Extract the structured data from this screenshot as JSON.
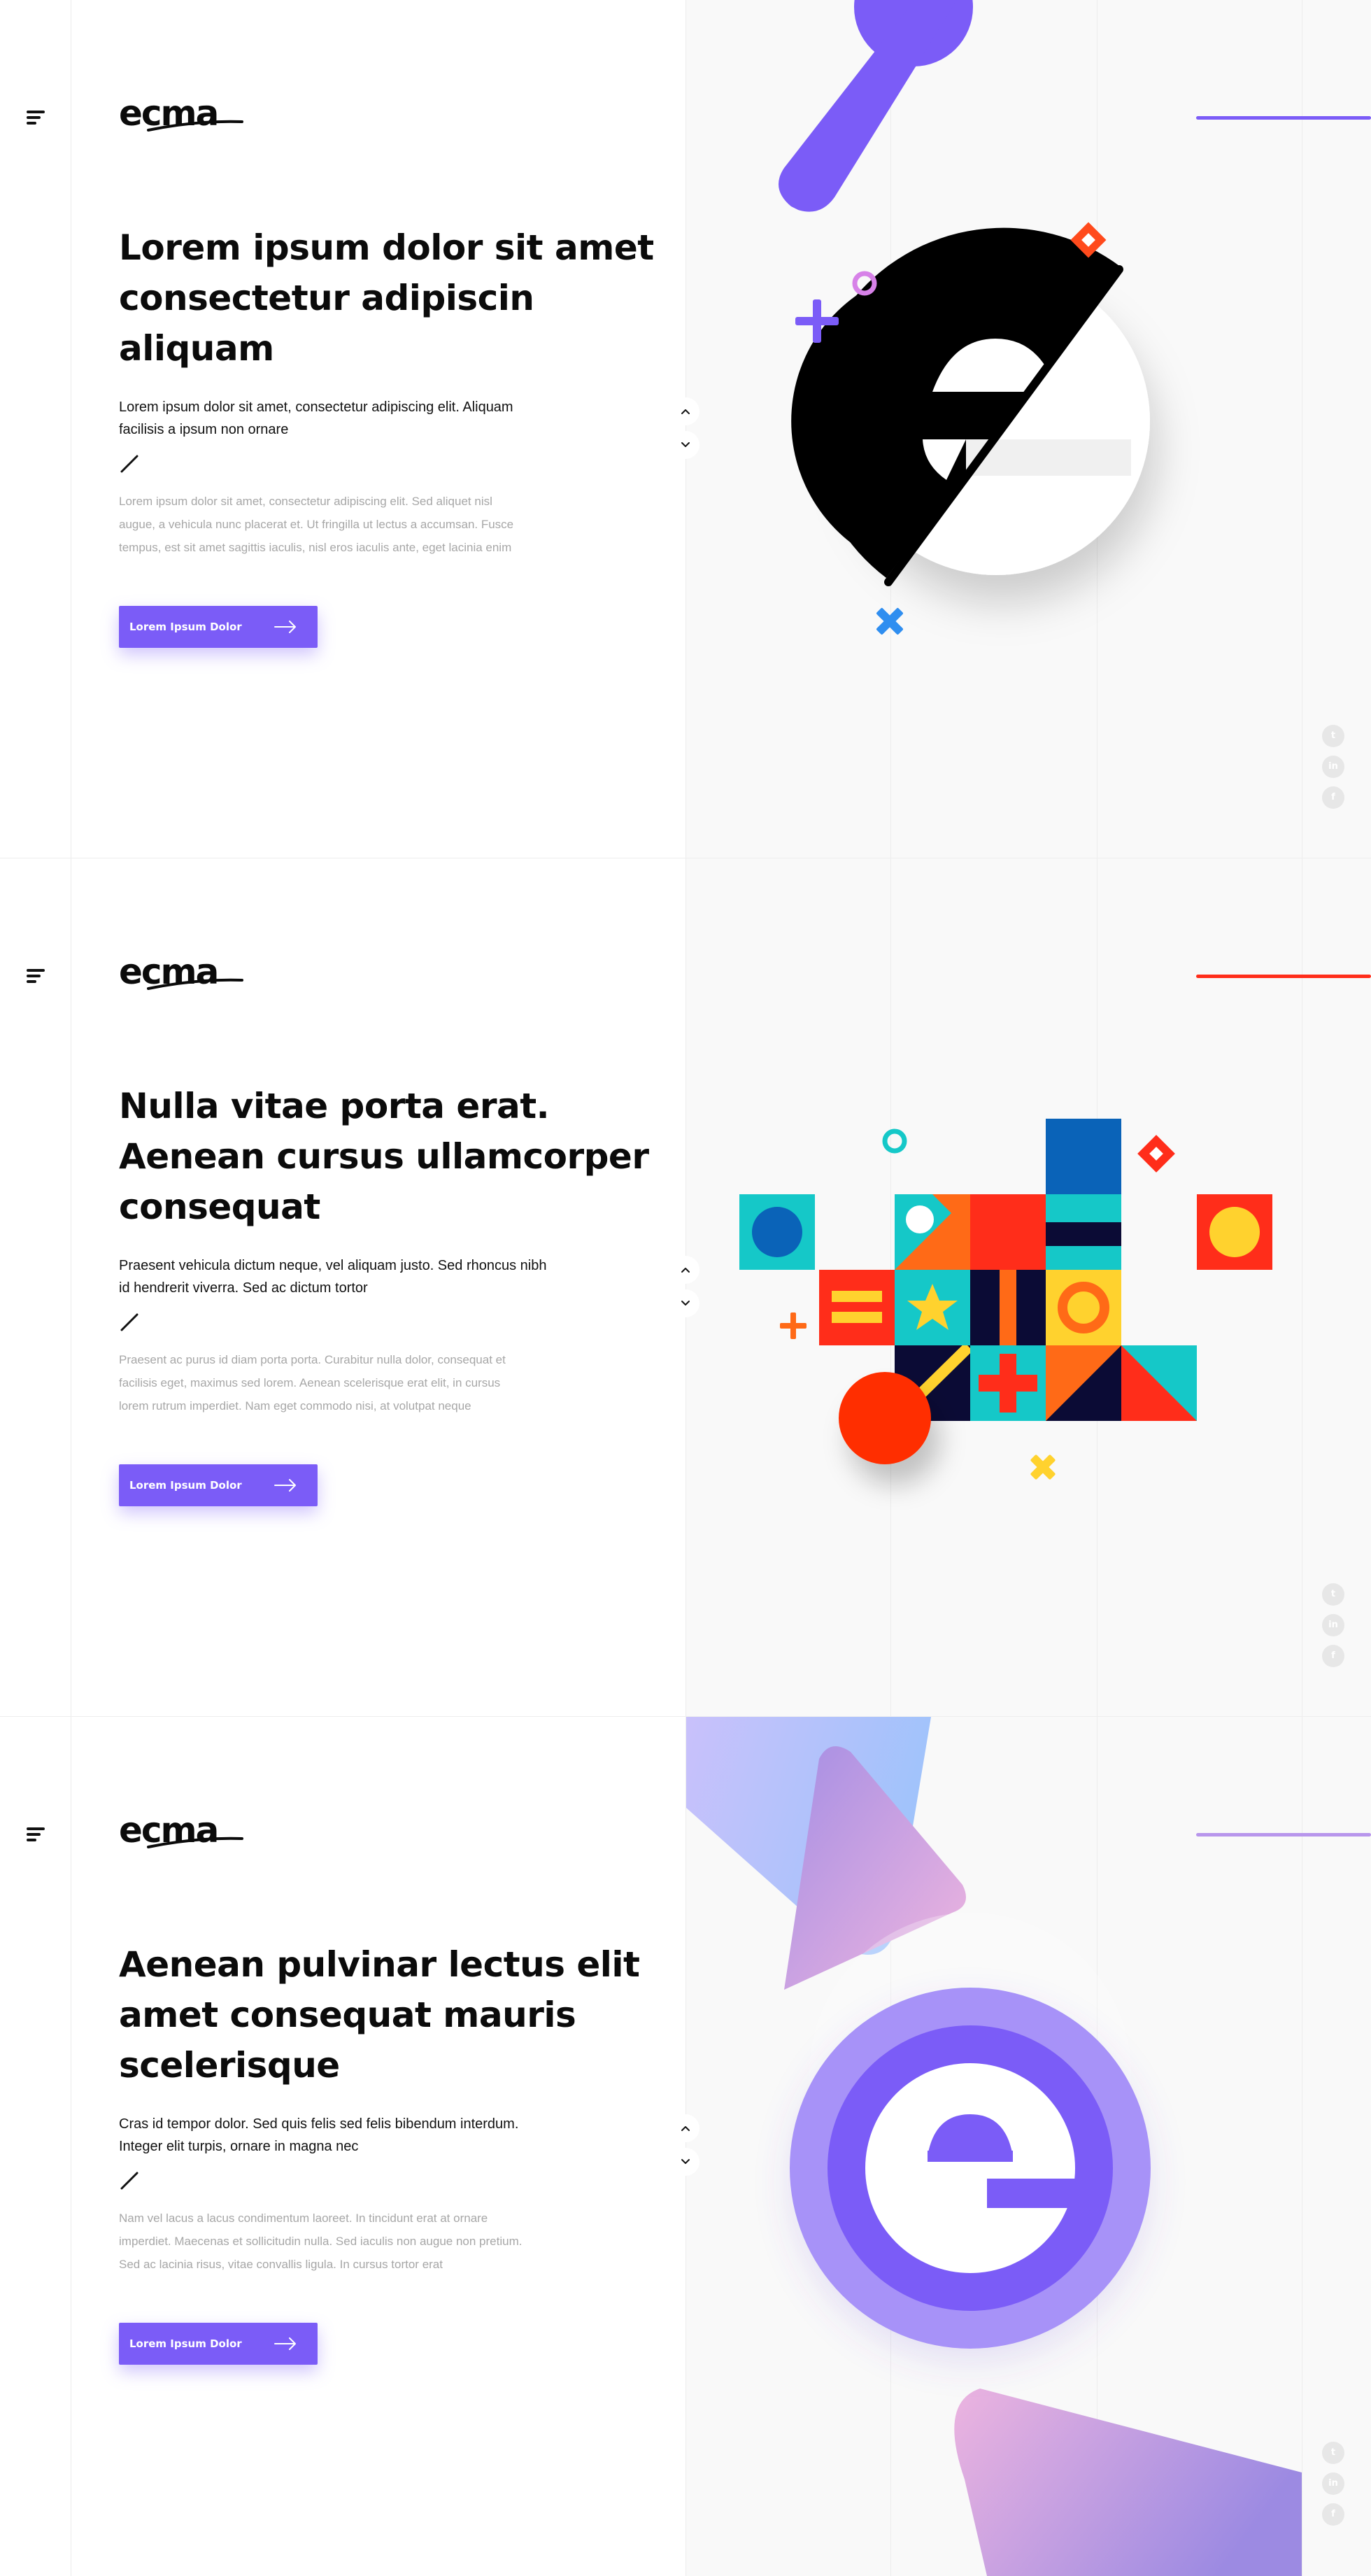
{
  "logo": {
    "text": "ecma"
  },
  "colors": {
    "accent": "#7b5cf7",
    "heading": "#0b0b0b",
    "body_muted": "#a7a7a7",
    "section2_accent_line": "#ff2d1a",
    "section3_accent_line": "#b896ec"
  },
  "icons": {
    "menu": "hamburger-menu-icon",
    "pager_up": "chevron-up-icon",
    "pager_down": "chevron-down-icon",
    "cta_arrow": "arrow-right-icon",
    "social": [
      "twitter-icon",
      "linkedin-icon",
      "facebook-icon"
    ]
  },
  "social_labels": [
    "t",
    "in",
    "f"
  ],
  "sections": [
    {
      "headline": "Lorem ipsum dolor sit amet consectetur adipiscin aliquam",
      "lead": "Lorem ipsum dolor sit amet, consectetur adipiscing elit. Aliquam facilisis a ipsum non ornare",
      "body": "Lorem ipsum dolor sit amet, consectetur adipiscing elit. Sed aliquet nisl augue, a vehicula nunc placerat et. Ut fringilla ut lectus a accumsan. Fusce tempus, est sit amet sagittis iaculis, nisl eros iaculis ante, eget lacinia enim",
      "cta_label": "Lorem Ipsum Dolor"
    },
    {
      "headline": "Nulla vitae porta erat. Aenean cursus ullamcorper consequat",
      "lead": "Praesent vehicula dictum neque, vel aliquam justo. Sed rhoncus nibh id hendrerit viverra. Sed ac dictum tortor",
      "body": "Praesent ac purus id diam porta porta. Curabitur nulla dolor, consequat et facilisis eget, maximus sed lorem. Aenean scelerisque erat elit, in cursus lorem rutrum imperdiet. Nam eget commodo nisi, at volutpat neque",
      "cta_label": "Lorem Ipsum Dolor"
    },
    {
      "headline": "Aenean pulvinar lectus elit amet consequat mauris scelerisque",
      "lead": "Cras id tempor dolor. Sed quis felis sed felis bibendum interdum. Integer elit turpis, ornare in magna nec",
      "body": "Nam vel lacus a lacus condimentum laoreet. In tincidunt erat at ornare imperdiet. Maecenas et sollicitudin nulla. Sed iaculis non augue non pretium. Sed ac lacinia risus, vitae convallis ligula. In cursus tortor erat",
      "cta_label": "Lorem Ipsum Dolor"
    }
  ]
}
